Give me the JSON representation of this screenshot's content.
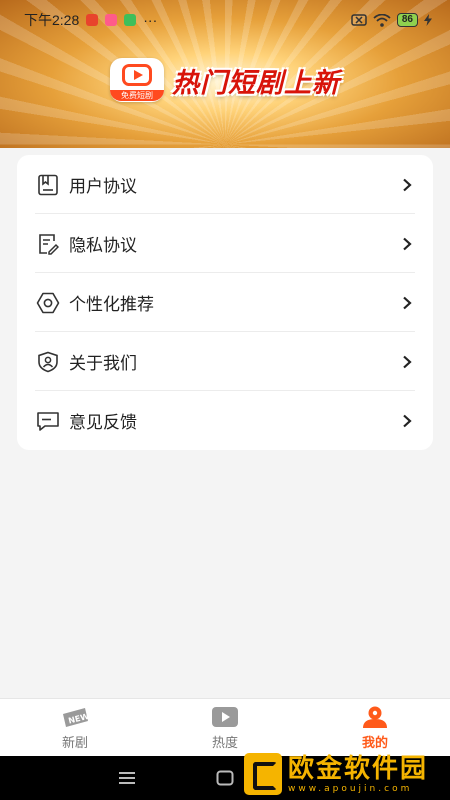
{
  "status_bar": {
    "time": "下午2:28",
    "more": "···",
    "battery": "86"
  },
  "banner": {
    "logo_text": "免费短剧",
    "title": "热门短剧上新"
  },
  "menu": {
    "items": [
      {
        "label": "用户协议",
        "icon": "document-icon"
      },
      {
        "label": "隐私协议",
        "icon": "edit-document-icon"
      },
      {
        "label": "个性化推荐",
        "icon": "gear-icon"
      },
      {
        "label": "关于我们",
        "icon": "user-shield-icon"
      },
      {
        "label": "意见反馈",
        "icon": "message-icon"
      }
    ]
  },
  "bottom_nav": {
    "tabs": [
      {
        "label": "新剧",
        "icon": "new-badge-icon",
        "active": false
      },
      {
        "label": "热度",
        "icon": "play-video-icon",
        "active": false
      },
      {
        "label": "我的",
        "icon": "profile-icon",
        "active": true
      }
    ],
    "accent_color": "#ff5a1a"
  },
  "watermark": {
    "title": "欧金软件园",
    "url": "www.apoujin.com"
  }
}
